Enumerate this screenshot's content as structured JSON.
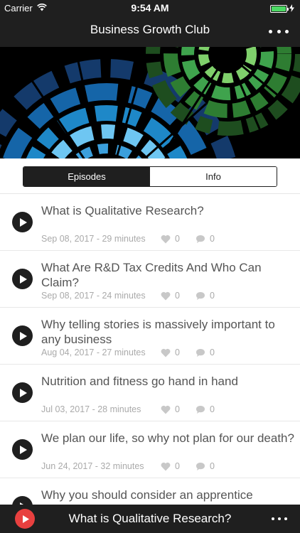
{
  "status_bar": {
    "carrier": "Carrier",
    "time": "9:54 AM",
    "icons": [
      "wifi-icon",
      "battery-icon",
      "charging-icon"
    ]
  },
  "nav": {
    "title": "Business Growth Club",
    "more_icon": "more-horizontal-icon"
  },
  "banner": {
    "colors": {
      "blue": "#1e88c8",
      "light_blue": "#6ec6f2",
      "green": "#3fa34d",
      "light_green": "#7fd06b"
    }
  },
  "tabs": [
    {
      "label": "Episodes",
      "active": true
    },
    {
      "label": "Info",
      "active": false
    }
  ],
  "episodes": [
    {
      "title": "What is Qualitative Research?",
      "meta": "Sep 08, 2017 - 29 minutes",
      "likes": "0",
      "comments": "0"
    },
    {
      "title": "What Are R&D Tax Credits And Who Can Claim?",
      "meta": "Sep 08, 2017 - 24 minutes",
      "likes": "0",
      "comments": "0"
    },
    {
      "title": "Why telling stories is massively important to any business",
      "meta": "Aug 04, 2017 - 27 minutes",
      "likes": "0",
      "comments": "0"
    },
    {
      "title": "Nutrition and fitness go hand in hand",
      "meta": "Jul 03, 2017 - 28 minutes",
      "likes": "0",
      "comments": "0"
    },
    {
      "title": "We plan our life, so why not plan for our death?",
      "meta": "Jun 24, 2017 - 32 minutes",
      "likes": "0",
      "comments": "0"
    },
    {
      "title": "Why you should consider an apprentice",
      "meta": "",
      "likes": "",
      "comments": ""
    }
  ],
  "player": {
    "title": "What is Qualitative Research?",
    "accent": "#e8403f"
  }
}
